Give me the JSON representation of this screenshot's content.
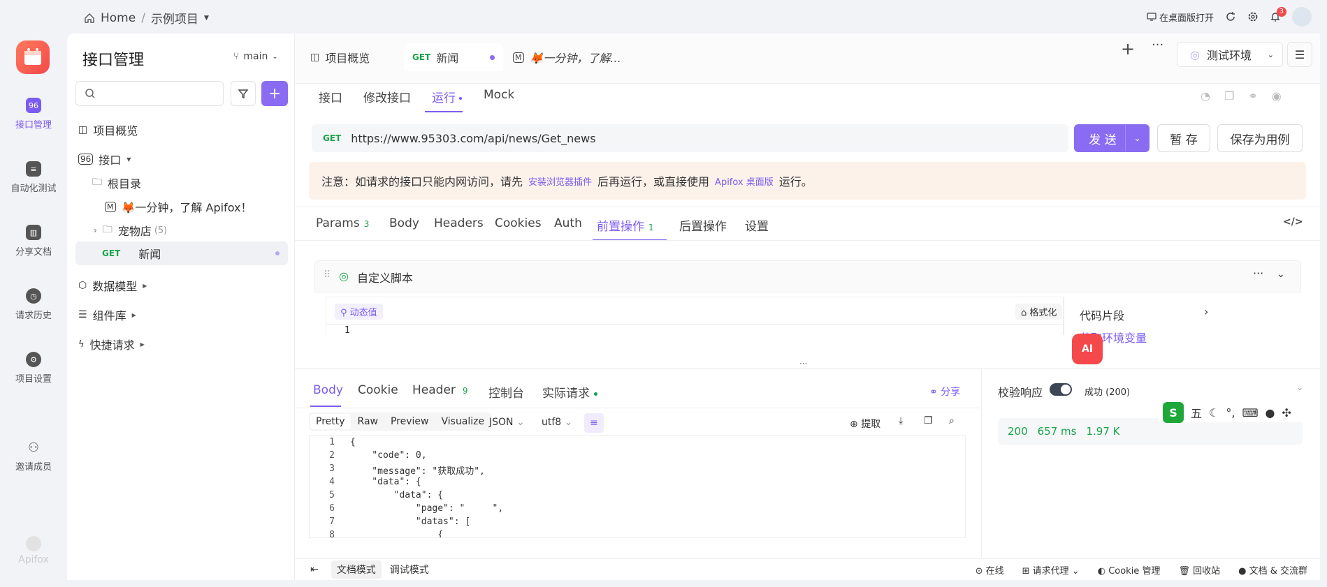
{
  "topbar": {
    "home": "Home",
    "separator": "/",
    "project": "示例项目",
    "open_desktop": "在桌面版打开",
    "notif_count": "3"
  },
  "nav": {
    "items": [
      "接口管理",
      "自动化测试",
      "分享文档",
      "请求历史",
      "项目设置",
      "邀请成员"
    ],
    "brand": "Apifox"
  },
  "side": {
    "title": "接口管理",
    "branch": "main",
    "tree": {
      "overview": "项目概览",
      "api": "接口",
      "root": "根目录",
      "doc_item": "🦊一分钟，了解 Apifox！",
      "doc_icon": "M",
      "petstore": "宠物店",
      "petstore_count": "(5)",
      "news_method": "GET",
      "news": "新闻",
      "models": "数据模型",
      "components": "组件库",
      "quick": "快捷请求"
    }
  },
  "tabs": {
    "overview": "项目概览",
    "news_method": "GET",
    "news": "新闻",
    "doc_icon": "M",
    "doc": "🦊一分钟，了解...",
    "env": "测试环境"
  },
  "subtabs": [
    "接口",
    "修改接口",
    "运行",
    "Mock"
  ],
  "url": {
    "method": "GET",
    "value": "https://www.95303.com/api/news/Get_news"
  },
  "buttons": {
    "send": "发 送",
    "save_temp": "暂 存",
    "save_case": "保存为用例"
  },
  "notice": {
    "p1": "注意：如请求的接口只能内网访问，请先",
    "link1": "安装浏览器插件",
    "p2": "后再运行，或直接使用",
    "link2": "Apifox 桌面版",
    "p3": "运行。"
  },
  "reqtabs": [
    {
      "label": "Params",
      "count": "3"
    },
    {
      "label": "Body",
      "count": ""
    },
    {
      "label": "Headers",
      "count": ""
    },
    {
      "label": "Cookies",
      "count": ""
    },
    {
      "label": "Auth",
      "count": ""
    },
    {
      "label": "前置操作",
      "count": "1"
    },
    {
      "label": "后置操作",
      "count": ""
    },
    {
      "label": "设置",
      "count": ""
    }
  ],
  "script": {
    "title": "自定义脚本",
    "dynamic": "动态值",
    "format": "格式化",
    "line1": "1",
    "snippet": "代码片段",
    "snippet_item": "获取环境变量"
  },
  "resp": {
    "tabs": [
      {
        "label": "Body",
        "count": ""
      },
      {
        "label": "Cookie",
        "count": ""
      },
      {
        "label": "Header",
        "count": "9"
      },
      {
        "label": "控制台",
        "count": ""
      },
      {
        "label": "实际请求",
        "count": ""
      }
    ],
    "share": "分享",
    "views": [
      "Pretty",
      "Raw",
      "Preview",
      "Visualize"
    ],
    "format": "JSON",
    "encoding": "utf8",
    "extract": "提取",
    "validate": "校验响应",
    "status": "成功 (200)",
    "code": "200",
    "time": "657 ms",
    "size": "1.97 K",
    "lines": [
      {
        "n": "1",
        "t": "{"
      },
      {
        "n": "2",
        "t": "    \"code\": 0,"
      },
      {
        "n": "3",
        "t": "    \"message\": \"获取成功\","
      },
      {
        "n": "4",
        "t": "    \"data\": {"
      },
      {
        "n": "5",
        "t": "        \"data\": {"
      },
      {
        "n": "6",
        "t": "            \"page\": \"     \","
      },
      {
        "n": "7",
        "t": "            \"datas\": ["
      },
      {
        "n": "8",
        "t": "                {"
      }
    ]
  },
  "ime": {
    "label": "五"
  },
  "footer": {
    "doc_mode": "文档模式",
    "debug_mode": "调试模式",
    "online": "在线",
    "proxy": "请求代理",
    "cookie": "Cookie 管理",
    "trash": "回收站",
    "community": "文档 & 交流群"
  },
  "colors": {
    "accent": "#7b5cf0",
    "get": "#17a34a"
  }
}
